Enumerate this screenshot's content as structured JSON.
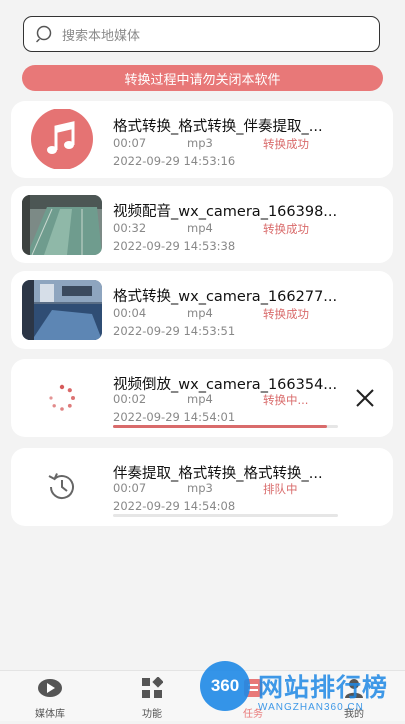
{
  "search": {
    "placeholder": "搜索本地媒体"
  },
  "banner": {
    "text": "转换过程中请勿关闭本软件"
  },
  "items": [
    {
      "title": "格式转换_格式转换_伴奏提取_...",
      "duration": "00:07",
      "format": "mp3",
      "status": "转换成功",
      "time": "2022-09-29 14:53:16",
      "thumb": "music-icon"
    },
    {
      "title": "视频配音_wx_camera_166398...",
      "duration": "00:32",
      "format": "mp4",
      "status": "转换成功",
      "time": "2022-09-29 14:53:38",
      "thumb": "video-thumbnail"
    },
    {
      "title": "格式转换_wx_camera_166277...",
      "duration": "00:04",
      "format": "mp4",
      "status": "转换成功",
      "time": "2022-09-29 14:53:51",
      "thumb": "video-thumbnail"
    },
    {
      "title": "视频倒放_wx_camera_166354...",
      "duration": "00:02",
      "format": "mp4",
      "status": "转换中...",
      "time": "2022-09-29 14:54:01",
      "thumb": "loading-spinner-icon",
      "progress": 0.95
    },
    {
      "title": "伴奏提取_格式转换_格式转换_...",
      "duration": "00:07",
      "format": "mp3",
      "status": "排队中",
      "time": "2022-09-29 14:54:08",
      "thumb": "history-icon",
      "progress": 0
    }
  ],
  "tabs": [
    {
      "label": "媒体库",
      "icon": "media-library-icon"
    },
    {
      "label": "功能",
      "icon": "grid-icon"
    },
    {
      "label": "任务",
      "icon": "task-icon"
    },
    {
      "label": "我的",
      "icon": "profile-icon"
    }
  ],
  "watermark": {
    "badge": "360",
    "text": "网站排行榜",
    "url": "WANGZHAN360.CN"
  },
  "colors": {
    "accent": "#e87878",
    "status": "#d96b6b",
    "music_bg": "#e57373"
  }
}
